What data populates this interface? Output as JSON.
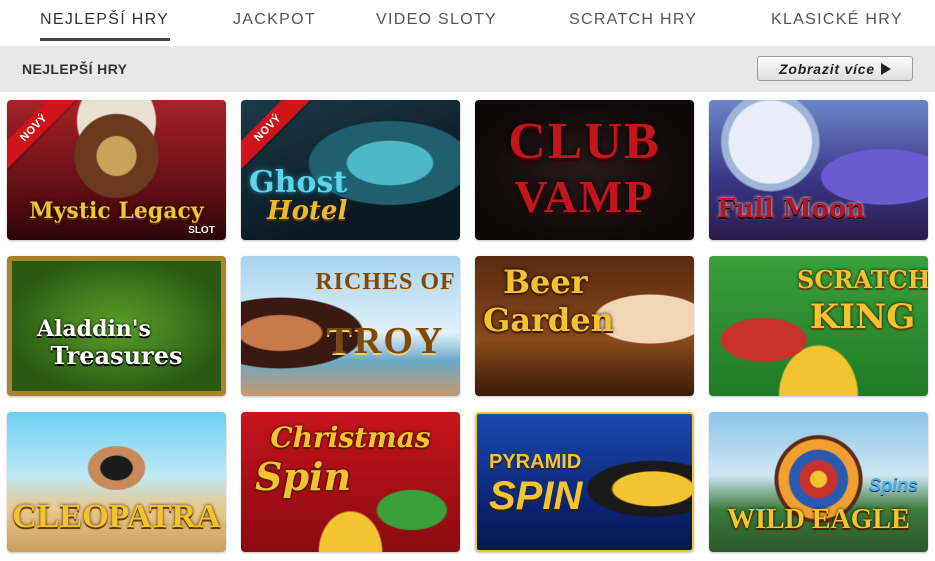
{
  "tabs": [
    {
      "label": "NEJLEPŠÍ HRY",
      "active": true
    },
    {
      "label": "JACKPOT",
      "active": false
    },
    {
      "label": "VIDEO SLOTY",
      "active": false
    },
    {
      "label": "SCRATCH HRY",
      "active": false
    },
    {
      "label": "KLASICKÉ HRY",
      "active": false
    }
  ],
  "section": {
    "title": "NEJLEPŠÍ HRY",
    "more_label": "Zobrazit více"
  },
  "badge_text": "NOVÝ",
  "games": [
    {
      "title": "Mystic Legacy",
      "subtitle": "SLOT",
      "is_new": true
    },
    {
      "title": "Ghost",
      "subtitle": "Hotel",
      "is_new": true
    },
    {
      "title": "CLUB",
      "subtitle": "VAMP",
      "is_new": false
    },
    {
      "title": "Full Moon",
      "subtitle": "",
      "is_new": false
    },
    {
      "title": "Aladdin's",
      "subtitle": "Treasures",
      "is_new": false
    },
    {
      "title": "RICHES OF",
      "subtitle": "TROY",
      "is_new": false
    },
    {
      "title": "Beer",
      "subtitle": "Garden",
      "is_new": false
    },
    {
      "title": "SCRATCH",
      "subtitle": "KING",
      "is_new": false
    },
    {
      "title": "CLEOPATRA",
      "subtitle": "",
      "is_new": false
    },
    {
      "title": "Christmas",
      "subtitle": "Spin",
      "is_new": false
    },
    {
      "title": "PYRAMID",
      "subtitle": "SPIN",
      "is_new": false
    },
    {
      "title": "WILD EAGLE",
      "subtitle": "Spins",
      "is_new": false
    }
  ],
  "colors": {
    "badge_red": "#d0141c",
    "section_bg": "#e8e8e8"
  }
}
